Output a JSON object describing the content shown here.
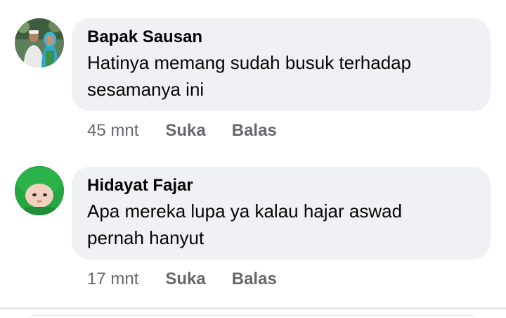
{
  "comments": [
    {
      "author": "Bapak Sausan",
      "line1": "Hatinya memang sudah busuk terhadap",
      "line2": "sesamanya ini",
      "time": "45 mnt",
      "like_label": "Suka",
      "reply_label": "Balas",
      "avatar_icon": "couple-photo-avatar"
    },
    {
      "author": "Hidayat Fajar",
      "line1": "Apa mereka lupa ya kalau hajar aswad",
      "line2": "pernah hanyut",
      "time": "17 mnt",
      "like_label": "Suka",
      "reply_label": "Balas",
      "avatar_icon": "baby-green-hood-avatar"
    }
  ],
  "colors": {
    "bubble_bg": "#eff1f4",
    "text_primary": "#050505",
    "text_secondary": "#65676b",
    "divider": "#e1e3e6"
  }
}
